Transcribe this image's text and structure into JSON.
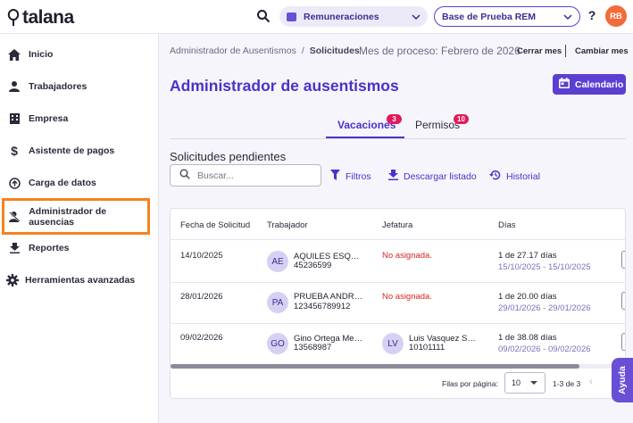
{
  "topbar": {
    "logo_text": "talana",
    "module": "Remuneraciones",
    "company": "Base de Prueba REM",
    "help": "?",
    "user_initials": "RB"
  },
  "sidebar": {
    "items": [
      {
        "label": "Inicio",
        "icon": "home-icon"
      },
      {
        "label": "Trabajadores",
        "icon": "person-icon"
      },
      {
        "label": "Empresa",
        "icon": "building-icon"
      },
      {
        "label": "Asistente de pagos",
        "icon": "dollar-icon"
      },
      {
        "label": "Carga de datos",
        "icon": "upload-circle-icon"
      },
      {
        "label": "Administrador de ausencias",
        "icon": "person-off-icon"
      },
      {
        "label": "Reportes",
        "icon": "download-icon"
      },
      {
        "label": "Herramientas avanzadas",
        "icon": "gear-icon"
      }
    ],
    "active_index": 5
  },
  "header": {
    "breadcrumb_root": "Administrador de Ausentismos",
    "breadcrumb_sep": "/",
    "breadcrumb_current": "Solicitudes",
    "process_month": "Mes de proceso: Febrero de 2026",
    "close_month": "Cerrar mes",
    "change_month": "Cambiar mes",
    "title": "Administrador de ausentismos",
    "calendar_button": "Calendario"
  },
  "tabs": [
    {
      "label": "Vacaciones",
      "badge": "3",
      "active": true
    },
    {
      "label": "Permisos",
      "badge": "10",
      "active": false
    }
  ],
  "section_title": "Solicitudes pendientes",
  "search": {
    "placeholder": "Buscar...",
    "value": ""
  },
  "actions": {
    "filters": "Filtros",
    "download": "Descargar listado",
    "history": "Historial"
  },
  "table": {
    "columns": [
      "Fecha de Solicitud",
      "Trabajador",
      "Jefatura",
      "Días"
    ],
    "rows": [
      {
        "date": "14/10/2025",
        "initials": "AE",
        "name": "AQUILES ESQUIV...",
        "rut": "45236599",
        "boss": "No asignada.",
        "days": "1 de 27.17 días",
        "range": "15/10/2025 - 15/10/2025"
      },
      {
        "date": "28/01/2026",
        "initials": "PA",
        "name": "PRUEBA ANDREE...",
        "rut": "123456789912",
        "boss": "No asignada.",
        "days": "1 de 20.00 días",
        "range": "29/01/2026 - 29/01/2026"
      },
      {
        "date": "09/02/2026",
        "initials": "GO",
        "name": "Gino Ortega Med...",
        "rut": "13568987",
        "boss_initials": "LV",
        "boss_name": "Luis Vasquez Sar...",
        "boss_rut": "10101111",
        "days": "1 de 38.08 días",
        "range": "09/02/2026 - 09/02/2026"
      }
    ],
    "rows_per_page_label": "Filas por página:",
    "rows_per_page": "10",
    "range_label": "1-3 de 3",
    "prev_symbol": "‹"
  },
  "help_button": "Ayuda",
  "colors": {
    "accent": "#5b3fd1",
    "title": "#4a32c9",
    "badge": "#e2195a",
    "active_outline": "#f58220",
    "avatar": "#f26b3a",
    "error_text": "#d92424"
  }
}
